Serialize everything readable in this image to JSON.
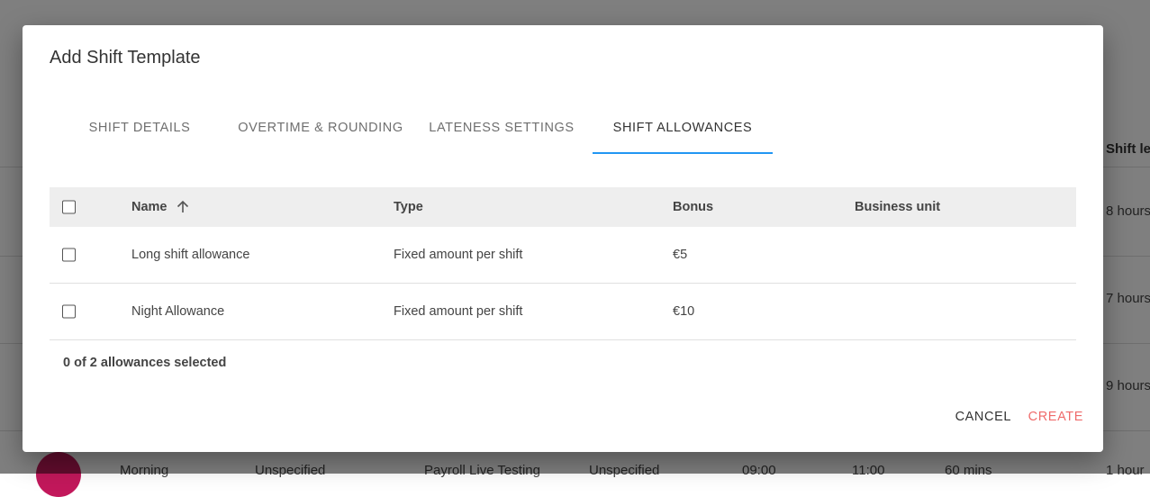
{
  "dialog": {
    "title": "Add Shift Template",
    "tabs": [
      {
        "label": "SHIFT DETAILS",
        "active": false
      },
      {
        "label": "OVERTIME & ROUNDING",
        "active": false
      },
      {
        "label": "LATENESS SETTINGS",
        "active": false
      },
      {
        "label": "SHIFT ALLOWANCES",
        "active": true
      }
    ],
    "table": {
      "columns": {
        "name": "Name",
        "type": "Type",
        "bonus": "Bonus",
        "business_unit": "Business unit"
      },
      "rows": [
        {
          "name": "Long shift allowance",
          "type": "Fixed amount per shift",
          "bonus": "€5",
          "business_unit": ""
        },
        {
          "name": "Night Allowance",
          "type": "Fixed amount per shift",
          "bonus": "€10",
          "business_unit": ""
        }
      ],
      "summary": "0 of 2 allowances selected"
    },
    "actions": {
      "cancel": "CANCEL",
      "create": "CREATE"
    }
  },
  "background": {
    "column_header": "Shift le",
    "column_values": [
      "8 hours",
      "7 hours",
      "9 hours"
    ],
    "bottom_row": {
      "name": "Morning",
      "type": "Unspecified",
      "unit": "Payroll Live Testing",
      "spec": "Unspecified",
      "start": "09:00",
      "end": "11:00",
      "break": "60 mins",
      "length": "1 hour"
    }
  },
  "colors": {
    "accent": "#2196f3",
    "create": "#ef6b6b",
    "overlay": "rgba(0,0,0,0.5)"
  }
}
